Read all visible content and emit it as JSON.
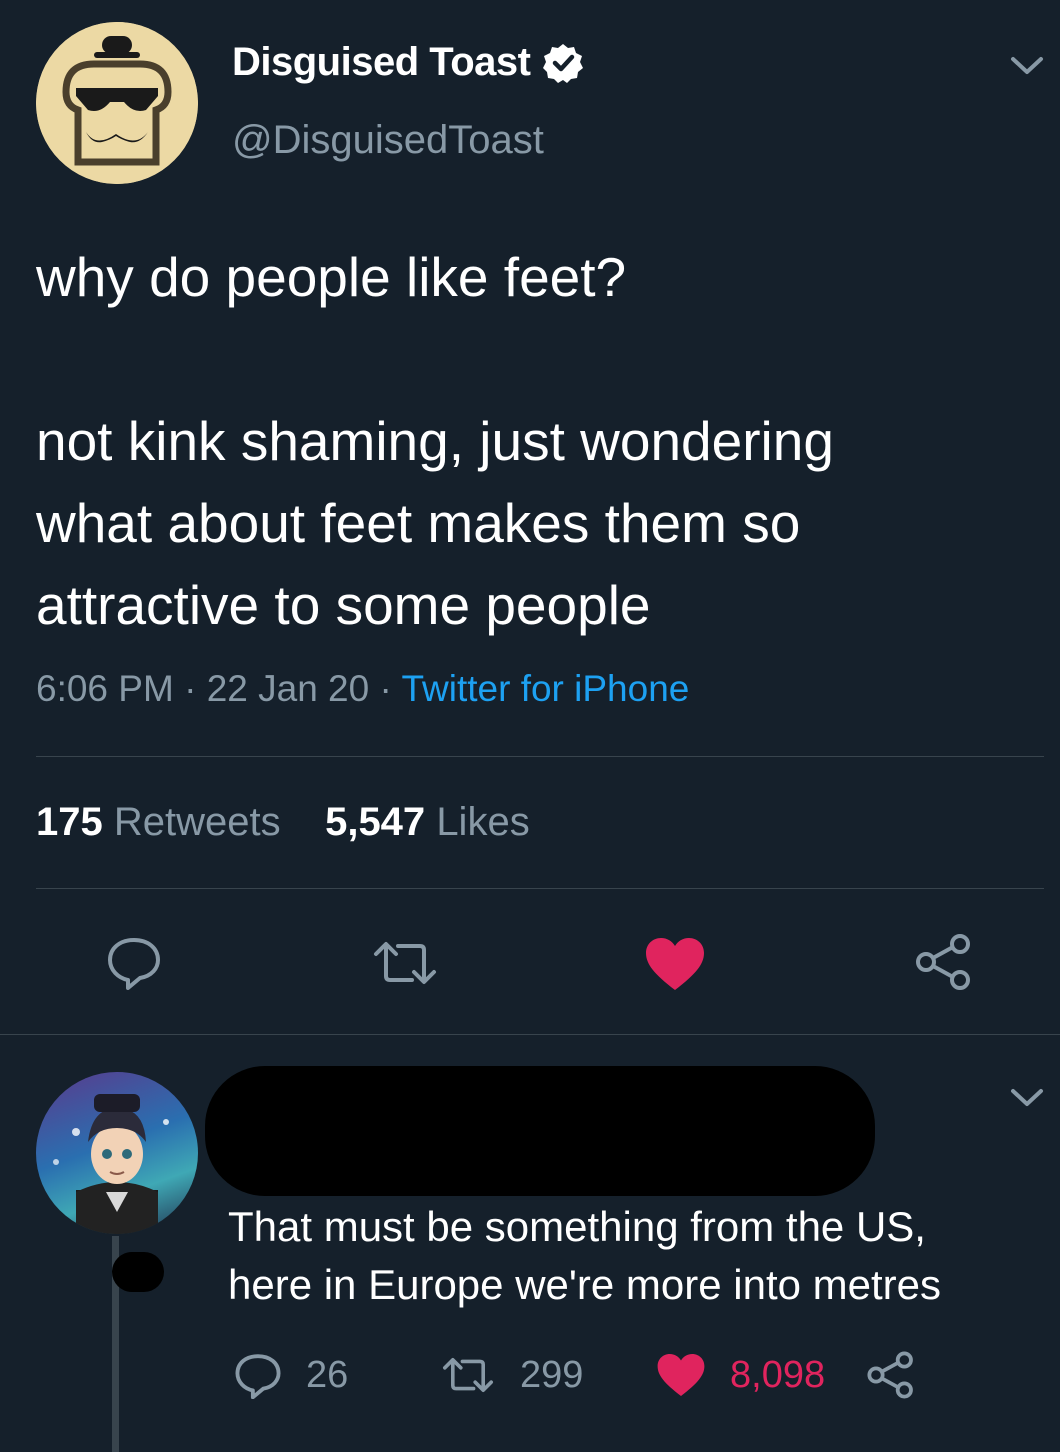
{
  "tweet": {
    "display_name": "Disguised Toast",
    "handle": "@DisguisedToast",
    "text_line1": "why do people like feet?",
    "text_para2_l1": "not kink shaming, just wondering",
    "text_para2_l2": "what about feet makes them so",
    "text_para2_l3": "attractive to some people",
    "time": "6:06 PM",
    "date": "22 Jan 20",
    "separator": "·",
    "source": "Twitter for iPhone",
    "retweets_count": "175",
    "retweets_label": "Retweets",
    "likes_count": "5,547",
    "likes_label": "Likes"
  },
  "reply": {
    "text_l1": "That must be something from the US,",
    "text_l2": "here in Europe we're more into metres",
    "reply_count": "26",
    "retweet_count": "299",
    "like_count": "8,098"
  },
  "icons": {
    "verified": "verified-badge-icon",
    "chevron": "chevron-down-icon",
    "reply": "reply-icon",
    "retweet": "retweet-icon",
    "like": "heart-icon",
    "share": "share-icon"
  },
  "colors": {
    "background": "#15202b",
    "accent": "#1da1f2",
    "like": "#e0245e",
    "muted": "#8899a6",
    "divider": "#38444d"
  }
}
